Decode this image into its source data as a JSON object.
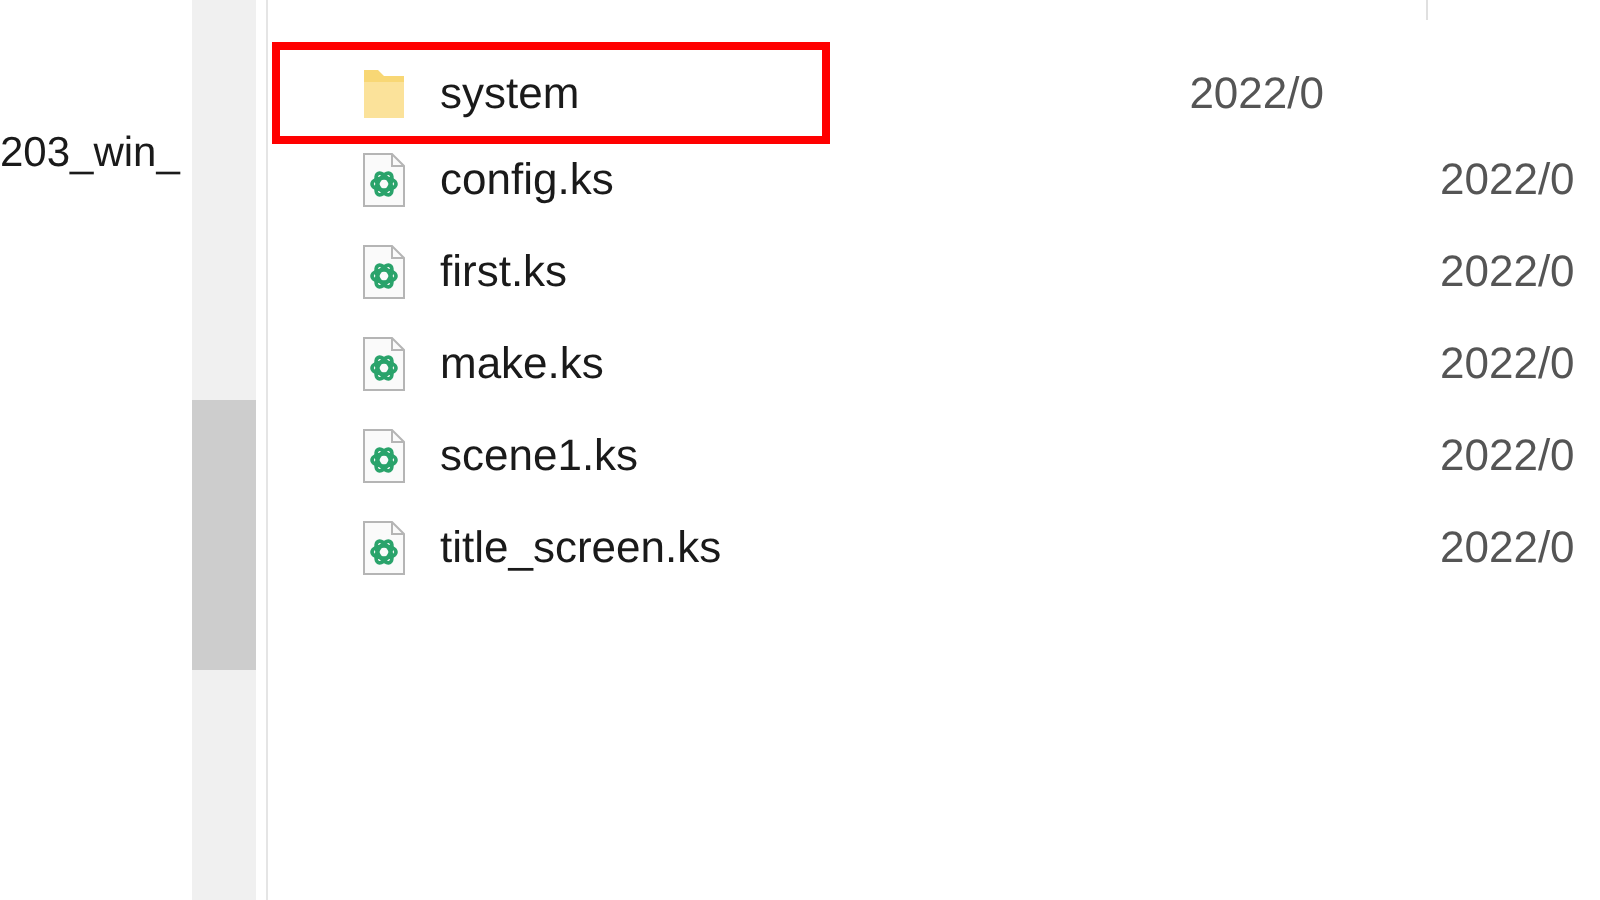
{
  "nav_pane": {
    "items": [
      {
        "label": "203_win_"
      }
    ]
  },
  "files": [
    {
      "name": "system",
      "kind": "folder",
      "date": "2022/0",
      "highlighted": true
    },
    {
      "name": "config.ks",
      "kind": "script",
      "date": "2022/0",
      "highlighted": false
    },
    {
      "name": "first.ks",
      "kind": "script",
      "date": "2022/0",
      "highlighted": false
    },
    {
      "name": "make.ks",
      "kind": "script",
      "date": "2022/0",
      "highlighted": false
    },
    {
      "name": "scene1.ks",
      "kind": "script",
      "date": "2022/0",
      "highlighted": false
    },
    {
      "name": "title_screen.ks",
      "kind": "script",
      "date": "2022/0",
      "highlighted": false
    }
  ]
}
